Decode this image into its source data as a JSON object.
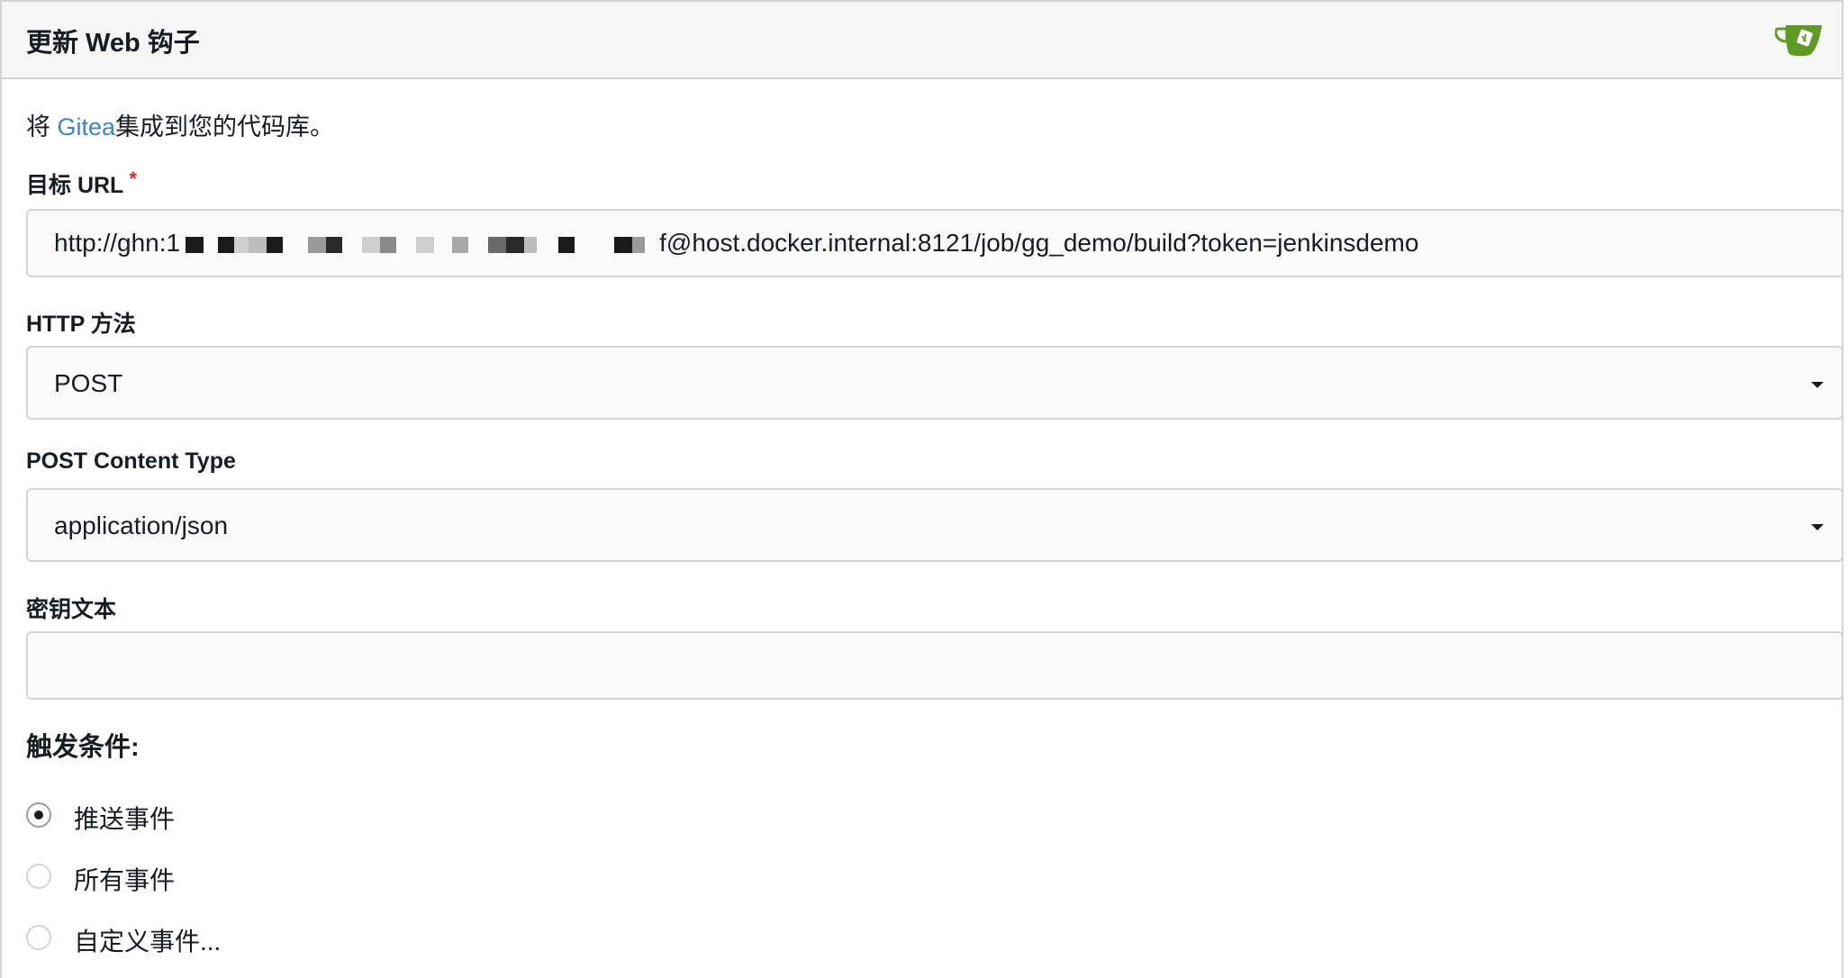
{
  "header": {
    "title": "更新 Web 钩子",
    "logo_icon": "gitea-logo-icon",
    "logo_color": "#609926"
  },
  "intro": {
    "prefix": "将 ",
    "link_text": "Gitea",
    "suffix": "集成到您的代码库。"
  },
  "target_url": {
    "label": "目标 URL",
    "required_mark": "*",
    "value_start": "http://ghn:1",
    "value_end": "f@host.docker.internal:8121/job/gg_demo/build?token=jenkinsdemo",
    "redacted_icon": "redacted-blocks"
  },
  "http_method": {
    "label": "HTTP 方法",
    "selected": "POST"
  },
  "content_type": {
    "label": "POST Content Type",
    "selected": "application/json"
  },
  "secret": {
    "label": "密钥文本",
    "value": ""
  },
  "trigger": {
    "title": "触发条件:",
    "options": [
      {
        "label": "推送事件",
        "checked": true
      },
      {
        "label": "所有事件",
        "checked": false
      },
      {
        "label": "自定义事件...",
        "checked": false
      }
    ]
  },
  "colors": {
    "link": "#4183c4",
    "border": "#d4d4d5",
    "required": "#db2828",
    "field_bg": "#fafafa",
    "header_bg": "#f6f6f6"
  }
}
